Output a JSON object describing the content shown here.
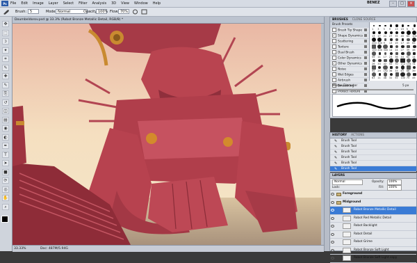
{
  "menu": {
    "logo": "Ps",
    "items": [
      "File",
      "Edit",
      "Image",
      "Layer",
      "Select",
      "Filter",
      "Analysis",
      "3D",
      "View",
      "Window",
      "Help"
    ],
    "workspace": "BENEZ",
    "win_min": "–",
    "win_max": "□",
    "win_close": "×"
  },
  "options": {
    "brush_label": "Brush:",
    "brush_size": "5",
    "mode_label": "Mode:",
    "mode_value": "Normal",
    "opacity_label": "Opacity:",
    "opacity_value": "100%",
    "flow_label": "Flow:",
    "flow_value": "70%"
  },
  "document": {
    "tab_title": "Doumbeldorov.psd @ 33.3% (Robot Bronze Metallic Detail, RGB/8) *",
    "zoom": "33.33%",
    "doc_info": "Doc: 487M/5.94G"
  },
  "brushes_panel": {
    "tabs": [
      "BRUSHES",
      "CLONE SOURCE"
    ],
    "presets_label": "Brush Presets",
    "options": [
      {
        "label": "Brush Tip Shape",
        "checked": false
      },
      {
        "label": "Shape Dynamics",
        "checked": true
      },
      {
        "label": "Scattering",
        "checked": false
      },
      {
        "label": "Texture",
        "checked": false
      },
      {
        "label": "Dual Brush",
        "checked": false
      },
      {
        "label": "Color Dynamics",
        "checked": false
      },
      {
        "label": "Other Dynamics",
        "checked": true
      },
      {
        "label": "Noise",
        "checked": false
      },
      {
        "label": "Wet Edges",
        "checked": false
      },
      {
        "label": "Airbrush",
        "checked": false
      },
      {
        "label": "Smoothing",
        "checked": true
      },
      {
        "label": "Protect Texture",
        "checked": false
      }
    ],
    "master_diameter_label": "Master Diameter",
    "master_diameter_value": "5 px",
    "sizes": [
      "1",
      "3",
      "5",
      "9",
      "13",
      "19",
      "5",
      "9",
      "13",
      "17",
      "21",
      "27",
      "35",
      "45",
      "65",
      "100",
      "200",
      "300",
      "9",
      "13",
      "19",
      "17",
      "45",
      "65",
      "100",
      "200",
      "300",
      "14",
      "24",
      "27",
      "39",
      "46",
      "59",
      "11",
      "17",
      "23",
      "36",
      "44",
      "60",
      "14",
      "26",
      "33",
      "42",
      "55",
      "70",
      "112",
      "134",
      "74",
      "95",
      "29",
      "192",
      "36",
      "33",
      "63",
      "66",
      "39",
      "63",
      "11",
      "48",
      "32",
      "55",
      "100",
      "75",
      "45"
    ]
  },
  "history_panel": {
    "tabs": [
      "HISTORY",
      "ACTIONS"
    ],
    "items": [
      "Brush Tool",
      "Brush Tool",
      "Brush Tool",
      "Brush Tool",
      "Brush Tool",
      "Brush Tool"
    ]
  },
  "layers_panel": {
    "tabs": [
      "LAYERS"
    ],
    "blend_mode": "Normal",
    "opacity_label": "Opacity:",
    "opacity_value": "100%",
    "lock_label": "Lock:",
    "fill_label": "Fill:",
    "fill_value": "100%",
    "layers": [
      {
        "name": "Foreground",
        "group": true,
        "selected": false
      },
      {
        "name": "Midground",
        "group": true,
        "selected": false
      },
      {
        "name": "Robot Bronze Metallic Detail",
        "group": false,
        "selected": true
      },
      {
        "name": "Robot Red Metallic Detail",
        "group": false,
        "selected": false
      },
      {
        "name": "Robot Backlight",
        "group": false,
        "selected": false
      },
      {
        "name": "Robot Detail",
        "group": false,
        "selected": false
      },
      {
        "name": "Robot Grime",
        "group": false,
        "selected": false
      },
      {
        "name": "Robot Bronze Soft Light",
        "group": false,
        "selected": false
      },
      {
        "name": "Robot Bronze Soft Light copy",
        "group": false,
        "selected": false
      }
    ]
  },
  "colors": {
    "robot_red": "#b8434f",
    "bronze": "#d38a2c",
    "sky": "#f3e4c0",
    "selection": "#3a7bd5"
  },
  "tools": [
    "move-icon",
    "marquee-icon",
    "lasso-icon",
    "wand-icon",
    "crop-icon",
    "eyedropper-icon",
    "healing-icon",
    "brush-icon",
    "stamp-icon",
    "history-brush-icon",
    "eraser-icon",
    "gradient-icon",
    "blur-icon",
    "dodge-icon",
    "pen-icon",
    "type-icon",
    "path-select-icon",
    "shape-icon",
    "3d-rotate-icon",
    "3d-orbit-icon",
    "hand-icon",
    "zoom-icon"
  ]
}
